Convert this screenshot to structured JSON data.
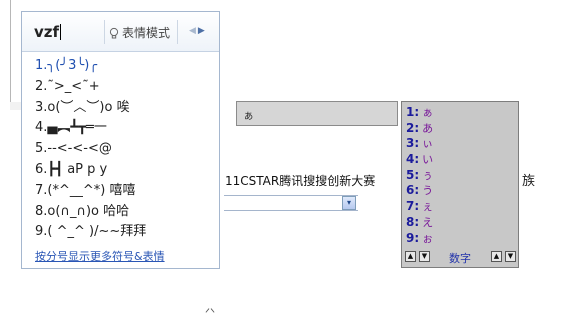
{
  "background": {
    "input_text": "ぁ",
    "link_text": "11CSTAR腾讯搜搜创新大赛",
    "edge_text": "族",
    "select_arrow": "▾",
    "scribble": "ᐟᐠ"
  },
  "ime": {
    "composition": "vzf",
    "mode_label": "表情模式",
    "mode_icon": "lightbulb-icon",
    "nav_prev": "◀",
    "nav_next": "▶",
    "candidates": [
      "1.╮(╯3╰)╭",
      "2.˜>_<˜+",
      "3.o(︶︿︶)o 唉",
      "4.▄︻┻┳═一",
      "5.--<-<-<@",
      "6.┣┫ aP p y",
      "7.(*^__^*) 嘻嘻",
      "8.o(∩_∩)o 哈哈",
      "9.( ^_^ )/~~拜拜"
    ],
    "footer_link": "按分号显示更多符号&表情"
  },
  "kana_panel": {
    "rows": [
      {
        "num": "1:",
        "char": "ぁ"
      },
      {
        "num": "2:",
        "char": "あ"
      },
      {
        "num": "3:",
        "char": "ぃ"
      },
      {
        "num": "4:",
        "char": "い"
      },
      {
        "num": "5:",
        "char": "ぅ"
      },
      {
        "num": "6:",
        "char": "う"
      },
      {
        "num": "7:",
        "char": "ぇ"
      },
      {
        "num": "8:",
        "char": "え"
      },
      {
        "num": "9:",
        "char": "ぉ"
      }
    ],
    "label": "数字",
    "btn_up": "▲",
    "btn_down": "▼"
  },
  "colors": {
    "ime_border": "#a5b7cf",
    "candidate_selected": "#1f4fb0",
    "footer_link": "#2a56b5",
    "kana_bg": "#c8c8c8",
    "kana_num": "#1c1c9c",
    "kana_char": "#7a1a9a"
  }
}
